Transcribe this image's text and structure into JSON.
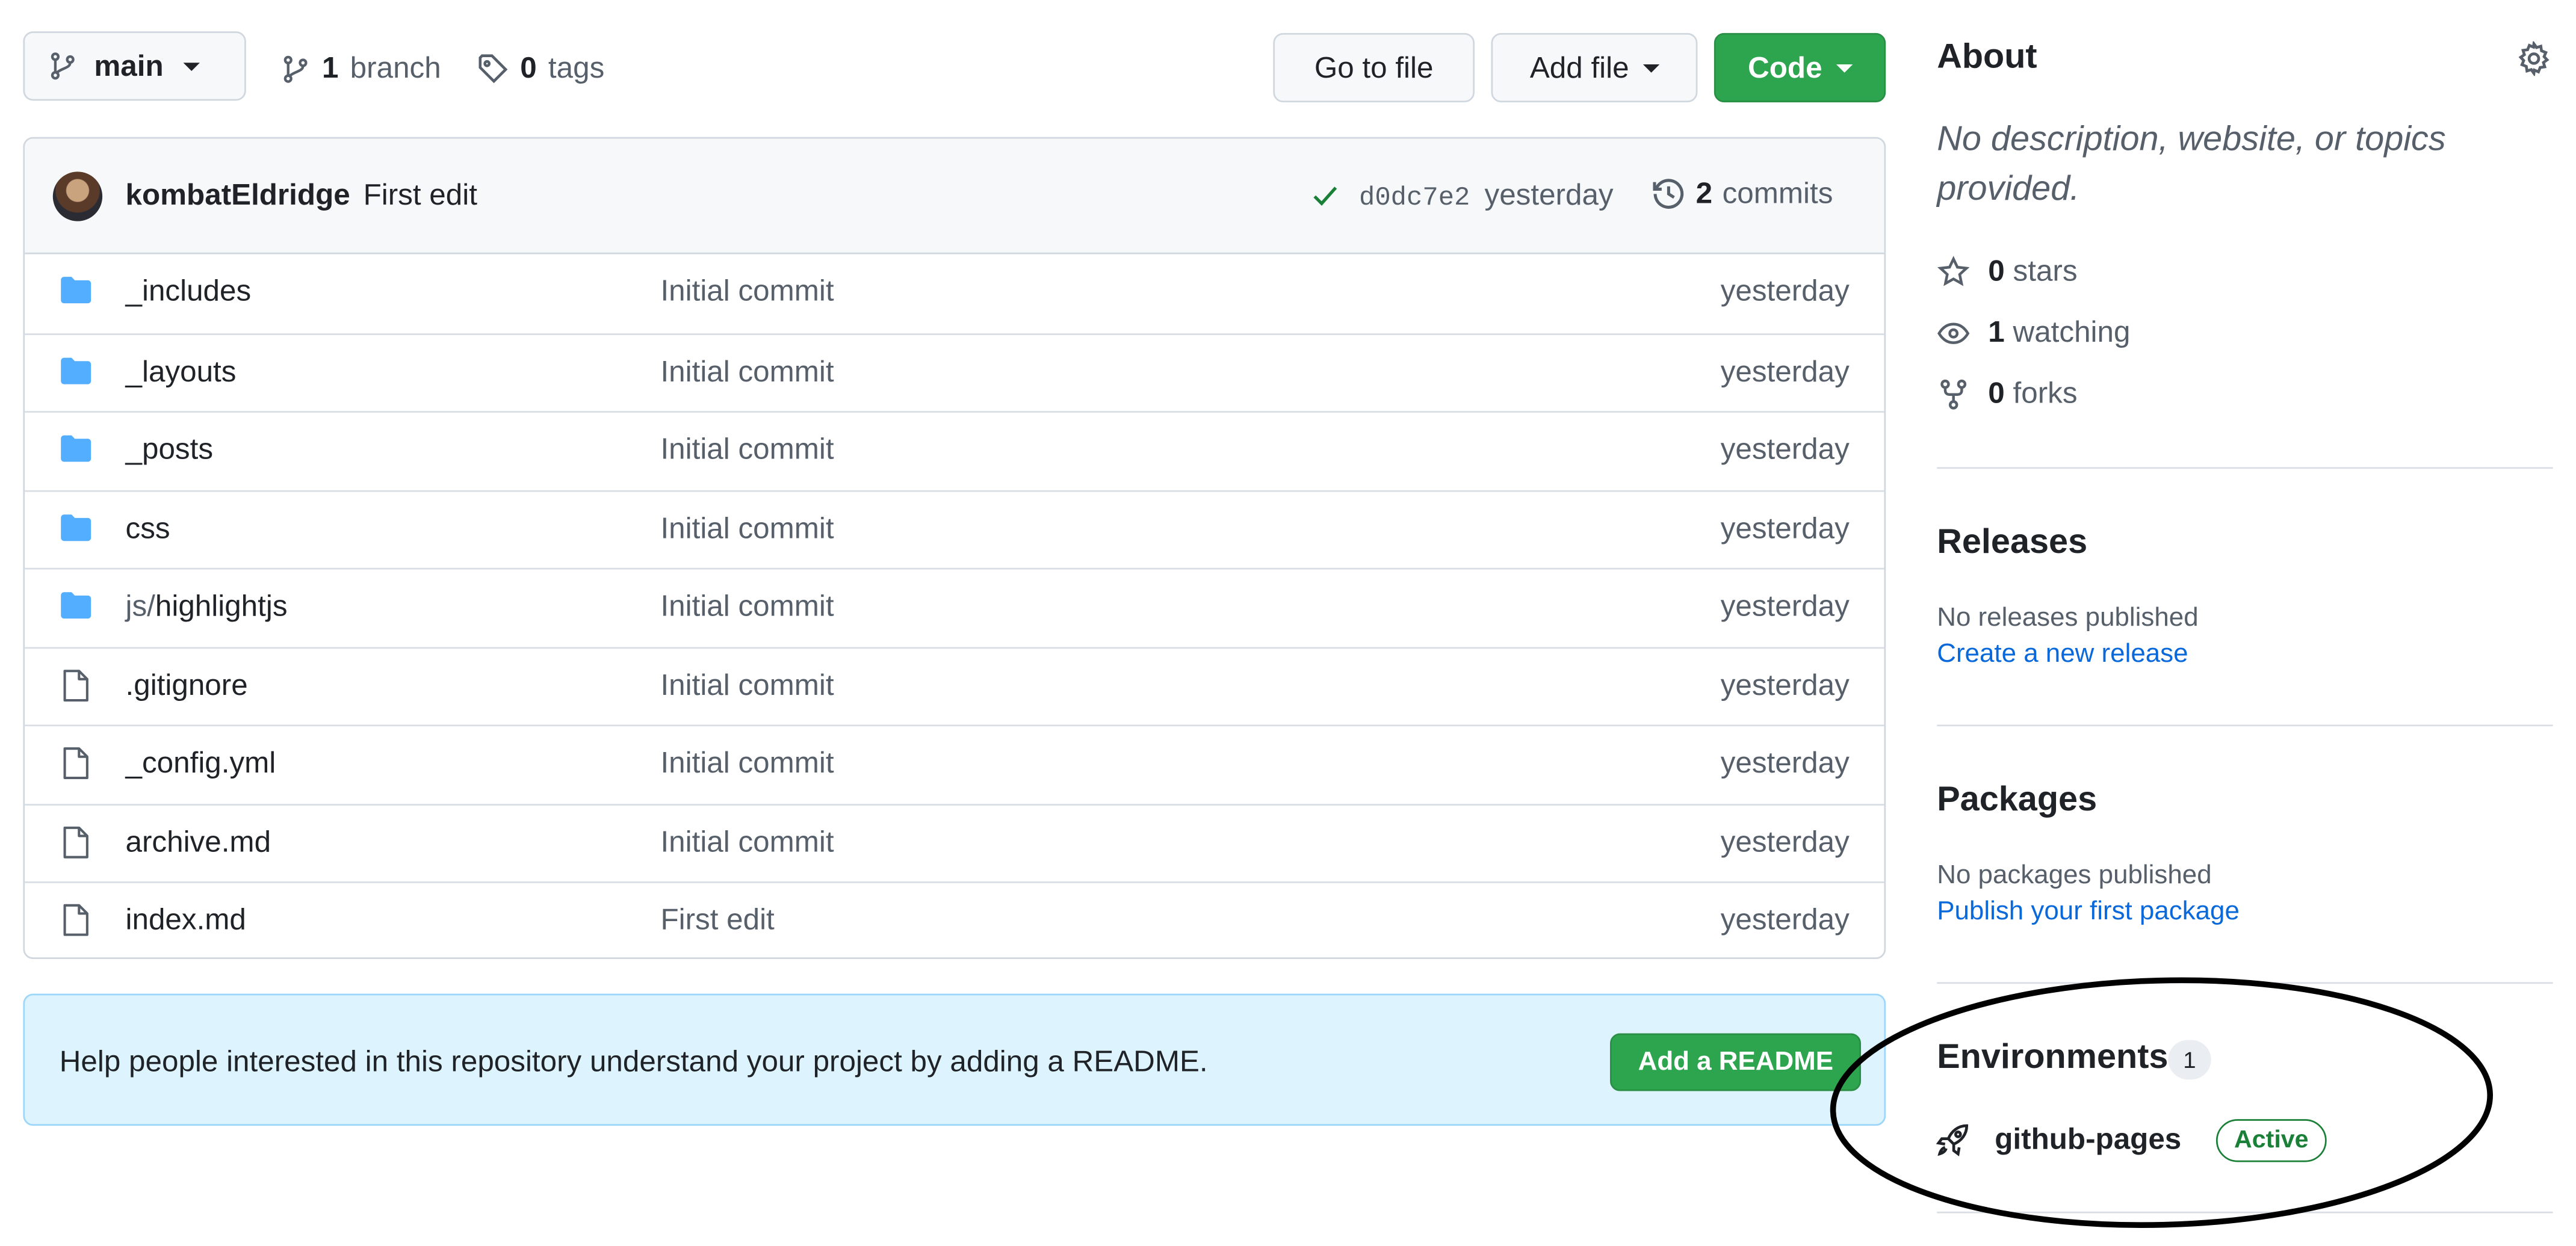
{
  "toolbar": {
    "branch_name": "main",
    "branch_count": "1",
    "branch_label": "branch",
    "tag_count": "0",
    "tag_label": "tags",
    "go_to_file": "Go to file",
    "add_file": "Add file",
    "code": "Code"
  },
  "commit": {
    "author": "kombatEldridge",
    "message": "First edit",
    "sha": "d0dc7e2",
    "age": "yesterday",
    "commit_count": "2",
    "commits_label": "commits"
  },
  "files": [
    {
      "type": "folder",
      "name": "_includes",
      "message": "Initial commit",
      "age": "yesterday"
    },
    {
      "type": "folder",
      "name": "_layouts",
      "message": "Initial commit",
      "age": "yesterday"
    },
    {
      "type": "folder",
      "name": "_posts",
      "message": "Initial commit",
      "age": "yesterday"
    },
    {
      "type": "folder",
      "name": "css",
      "message": "Initial commit",
      "age": "yesterday"
    },
    {
      "type": "folder",
      "name_prefix": "js/",
      "name": "highlightjs",
      "message": "Initial commit",
      "age": "yesterday"
    },
    {
      "type": "file",
      "name": ".gitignore",
      "message": "Initial commit",
      "age": "yesterday"
    },
    {
      "type": "file",
      "name": "_config.yml",
      "message": "Initial commit",
      "age": "yesterday"
    },
    {
      "type": "file",
      "name": "archive.md",
      "message": "Initial commit",
      "age": "yesterday"
    },
    {
      "type": "file",
      "name": "index.md",
      "message": "First edit",
      "age": "yesterday"
    }
  ],
  "readme_banner": {
    "text": "Help people interested in this repository understand your project by adding a README.",
    "button": "Add a README"
  },
  "about": {
    "heading": "About",
    "description_line1": "No description, website, or topics",
    "description_line2": "provided.",
    "stars_count": "0",
    "stars_label": "stars",
    "watching_count": "1",
    "watching_label": "watching",
    "forks_count": "0",
    "forks_label": "forks"
  },
  "releases": {
    "heading": "Releases",
    "empty_text": "No releases published",
    "create_link": "Create a new release"
  },
  "packages": {
    "heading": "Packages",
    "empty_text": "No packages published",
    "publish_link": "Publish your first package"
  },
  "environments": {
    "heading": "Environments",
    "count": "1",
    "name": "github-pages",
    "status": "Active"
  },
  "colors": {
    "primary_green": "#2da44e",
    "link_blue": "#0969da",
    "folder_blue": "#54aeff",
    "active_green": "#1a7f37",
    "annotation_ellipse": "#000000"
  },
  "icons": [
    "branch-icon",
    "tag-icon",
    "check-icon",
    "history-icon",
    "folder-icon",
    "file-icon",
    "gear-icon",
    "star-icon",
    "eye-icon",
    "fork-icon",
    "rocket-icon"
  ]
}
